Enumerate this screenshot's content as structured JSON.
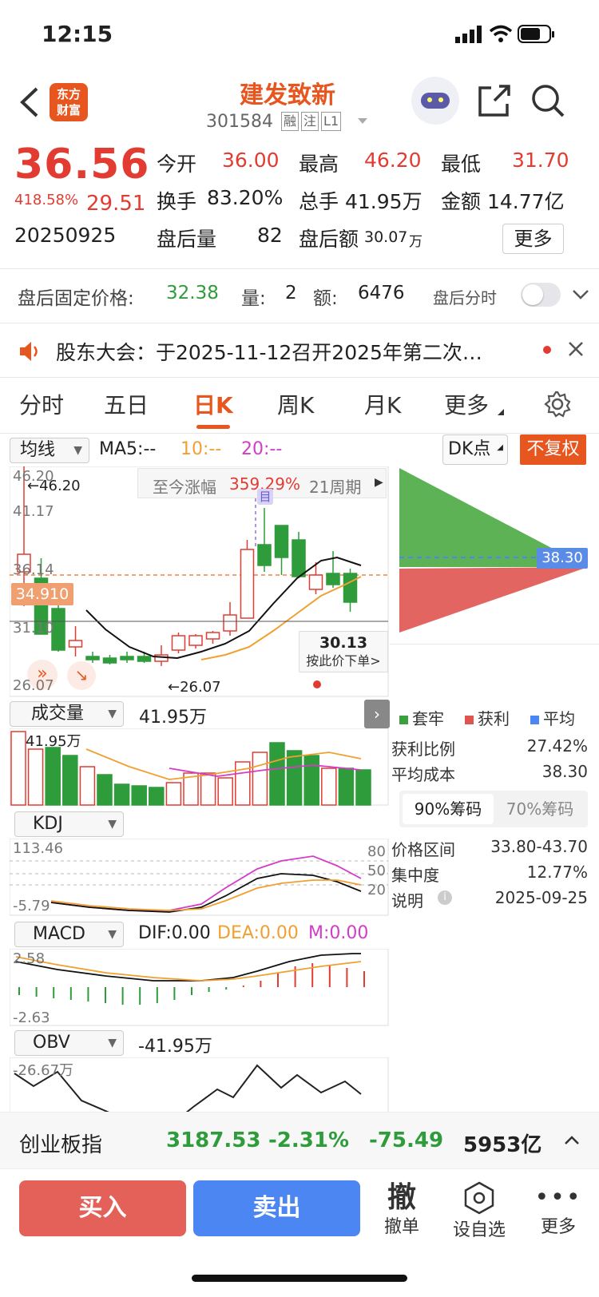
{
  "status_bar": {
    "time": "12:15"
  },
  "header": {
    "logo_text_line1": "东方",
    "logo_text_line2": "财富",
    "stock_name": "建发致新",
    "stock_code": "301584",
    "badges": [
      "融",
      "注",
      "L1"
    ]
  },
  "quote": {
    "price": "36.56",
    "change_pct": "418.58%",
    "change_amt": "29.51",
    "date": "20250925",
    "open_label": "今开",
    "open": "36.00",
    "high_label": "最高",
    "high": "46.20",
    "low_label": "最低",
    "low": "31.70",
    "turnover_label": "换手",
    "turnover": "83.20%",
    "volume_label": "总手",
    "volume": "41.95万",
    "amount_label": "金额",
    "amount": "14.77亿",
    "after_vol_label": "盘后量",
    "after_vol": "82",
    "after_amt_label": "盘后额",
    "after_amt": "30.07",
    "after_amt_unit": "万",
    "more_button": "更多"
  },
  "after_hours": {
    "fixed_price_label": "盘后固定价格:",
    "fixed_price": "32.38",
    "qty_label": "量:",
    "qty": "2",
    "amount_label": "额:",
    "amount": "6476",
    "time_share_label": "盘后分时"
  },
  "notice": {
    "text": "股东大会：于2025-11-12召开2025年第二次…"
  },
  "tabs": [
    "分时",
    "五日",
    "日K",
    "周K",
    "月K",
    "更多"
  ],
  "active_tab": "日K",
  "indicators": {
    "ma_select": "均线",
    "ma5": "MA5:--",
    "ma10": "10:--",
    "ma20": "20:--",
    "dk_button": "DK点",
    "fuquan_button": "不复权",
    "gain_banner_label": "至今涨幅",
    "gain_banner_value": "359.29%",
    "gain_banner_period": "21周期",
    "price_axis": [
      "46.20",
      "41.17",
      "36.14",
      "31.10",
      "26.07"
    ],
    "high_marker": "←46.20",
    "low_marker": "←26.07",
    "current_line": "34.910",
    "order_price": "30.13",
    "order_hint": "按此价下单>",
    "mu_label": "目",
    "volume_select": "成交量",
    "volume_value": "41.95万",
    "volume_axis_top": "41.95万",
    "kdj_select": "KDJ",
    "kdj_top": "113.46",
    "kdj_bottom": "-5.79",
    "kdj_levels": [
      "80",
      "50",
      "20"
    ],
    "macd_select": "MACD",
    "macd_dif": "DIF:0.00",
    "macd_dea": "DEA:0.00",
    "macd_m": "M:0.00",
    "macd_top": "2.58",
    "macd_bottom": "-2.63",
    "obv_select": "OBV",
    "obv_value": "-41.95万",
    "obv_top": "-26.67万"
  },
  "chip_panel": {
    "avg_price_tag": "38.30",
    "legend": [
      "套牢",
      "获利",
      "平均"
    ],
    "profit_ratio_label": "获利比例",
    "profit_ratio": "27.42%",
    "avg_cost_label": "平均成本",
    "avg_cost": "38.30",
    "tab_90": "90%筹码",
    "tab_70": "70%筹码",
    "range_label": "价格区间",
    "range": "33.80-43.70",
    "concentration_label": "集中度",
    "concentration": "12.77%",
    "note_label": "说明",
    "note_date": "2025-09-25"
  },
  "index_bar": {
    "name": "创业板指",
    "value": "3187.53",
    "pct": "-2.31%",
    "change": "-75.49",
    "amount": "5953亿"
  },
  "actions": {
    "buy": "买入",
    "sell": "卖出",
    "cancel_icon_char": "撤",
    "cancel_label": "撤单",
    "watch_label": "设自选",
    "more_label": "更多"
  },
  "colors": {
    "up": "#e23c32",
    "down": "#2e9c3a",
    "accent": "#e8561f",
    "buy": "#e4615a",
    "sell": "#4b86f2"
  }
}
